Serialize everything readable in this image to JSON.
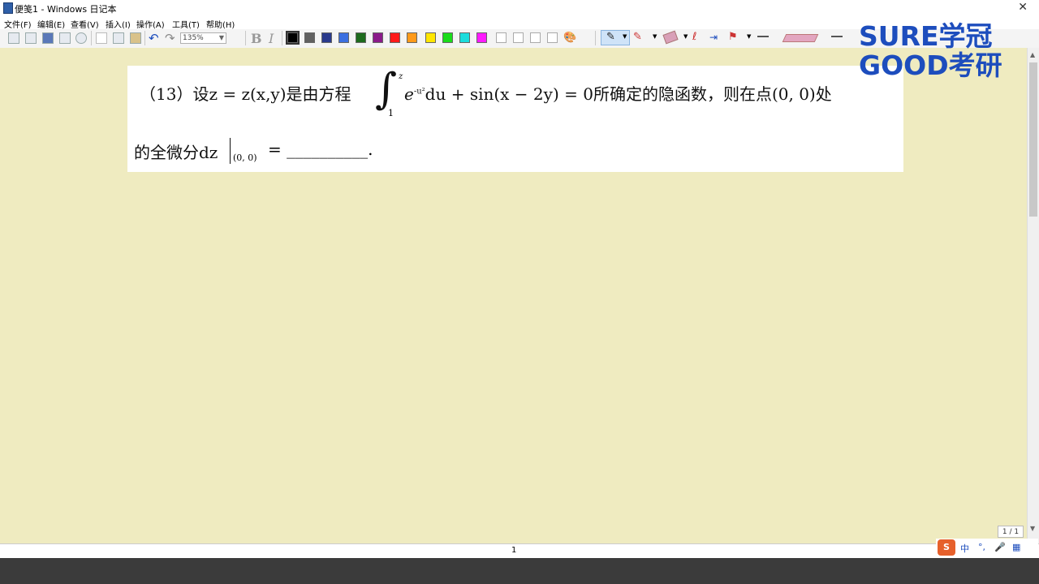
{
  "window": {
    "title": "便笺1 - Windows 日记本"
  },
  "menu": [
    "文件(F)",
    "编辑(E)",
    "查看(V)",
    "插入(I)",
    "操作(A)",
    "工具(T)",
    "帮助(H)"
  ],
  "toolbar": {
    "zoom": "135%",
    "bold_label": "B",
    "italic_label": "I",
    "colors": [
      "#000000",
      "#606060",
      "#2a3a8c",
      "#3b6fe0",
      "#1d6a1d",
      "#8a1a8a",
      "#ff1a1a",
      "#ff9a1a",
      "#ffe600",
      "#1adc1a",
      "#1adcdc",
      "#ff1aff",
      "#ffffff",
      "#ffffff",
      "#ffffff",
      "#ffffff"
    ]
  },
  "question": {
    "line1_before": "（13）设z = z(x,y)是由方程",
    "integral_upper": "z",
    "integral_lower": "1",
    "integrand_base": "e",
    "integrand_exp": "-u²",
    "line1_after": "du + sin(x − 2y) = 0所确定的隐函数，则在点(0, 0)处",
    "line2": "的全微分dz",
    "eval_point": "(0, 0)",
    "line2_end": "= __________."
  },
  "logo": {
    "line1": "SURE学冠",
    "line2": "GOOD考研"
  },
  "status": {
    "page": "1",
    "page_box": "1 / 1"
  },
  "ime": {
    "zh": "中",
    "punct": "°,",
    "mic": "🎤",
    "grid": "▦"
  }
}
